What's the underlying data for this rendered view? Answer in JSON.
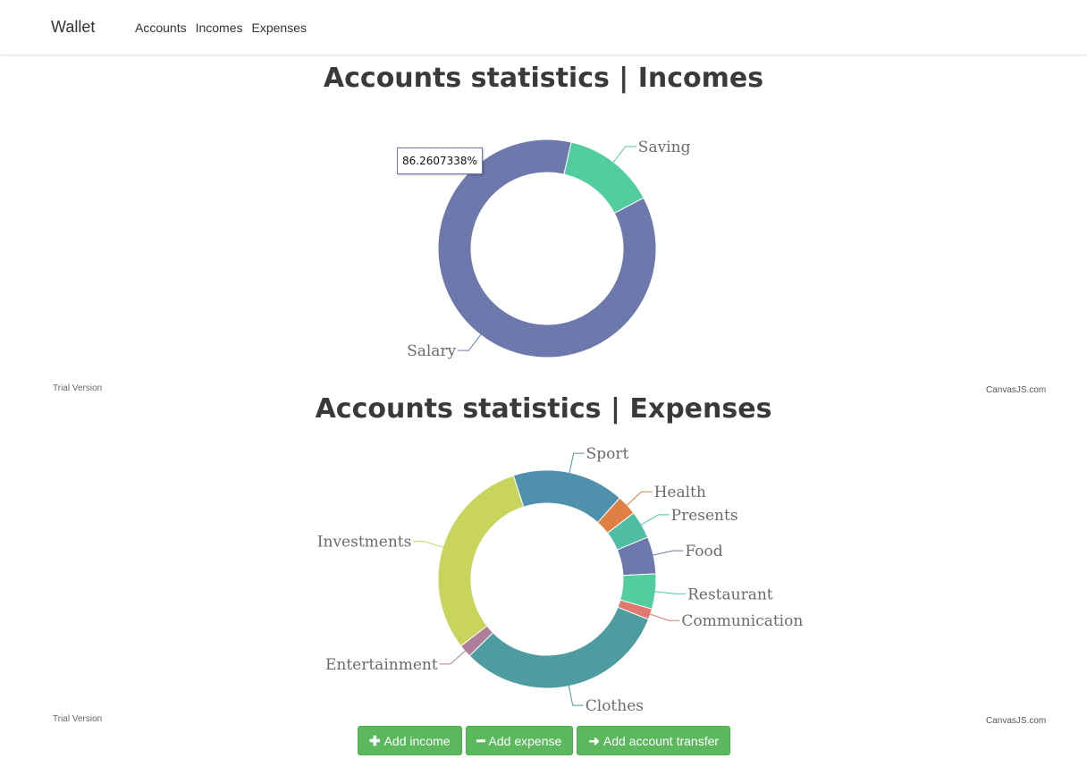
{
  "nav": {
    "brand": "Wallet",
    "links": [
      "Accounts",
      "Incomes",
      "Expenses"
    ]
  },
  "incomes_chart": {
    "title": "Accounts statistics | Incomes",
    "tooltip": "86.2607338%",
    "trial_text": "Trial Version",
    "credit_text": "CanvasJS.com"
  },
  "expenses_chart": {
    "title": "Accounts statistics | Expenses",
    "trial_text": "Trial Version",
    "credit_text": "CanvasJS.com"
  },
  "buttons": {
    "add_income": "Add income",
    "add_expense": "Add expense",
    "add_transfer": "Add account transfer"
  },
  "chart_data": [
    {
      "type": "pie",
      "subtype": "doughnut",
      "title": "Accounts statistics | Incomes",
      "labels": [
        "Salary",
        "Saving"
      ],
      "values": [
        86.26,
        13.74
      ],
      "colors": [
        "#6d78ad",
        "#51cda0"
      ]
    },
    {
      "type": "pie",
      "subtype": "doughnut",
      "title": "Accounts statistics | Expenses",
      "labels": [
        "Sport",
        "Health",
        "Presents",
        "Food",
        "Restaurant",
        "Communication",
        "Clothes",
        "Entertainment",
        "Investments"
      ],
      "values": [
        16.6,
        3.0,
        4.1,
        5.5,
        5.2,
        1.6,
        31.6,
        1.9,
        30.5
      ],
      "colors": [
        "#4f91ad",
        "#df7f44",
        "#4fbea4",
        "#6d78ad",
        "#51cda0",
        "#df7970",
        "#4c9ca0",
        "#ae7d99",
        "#c9d45c"
      ]
    }
  ]
}
